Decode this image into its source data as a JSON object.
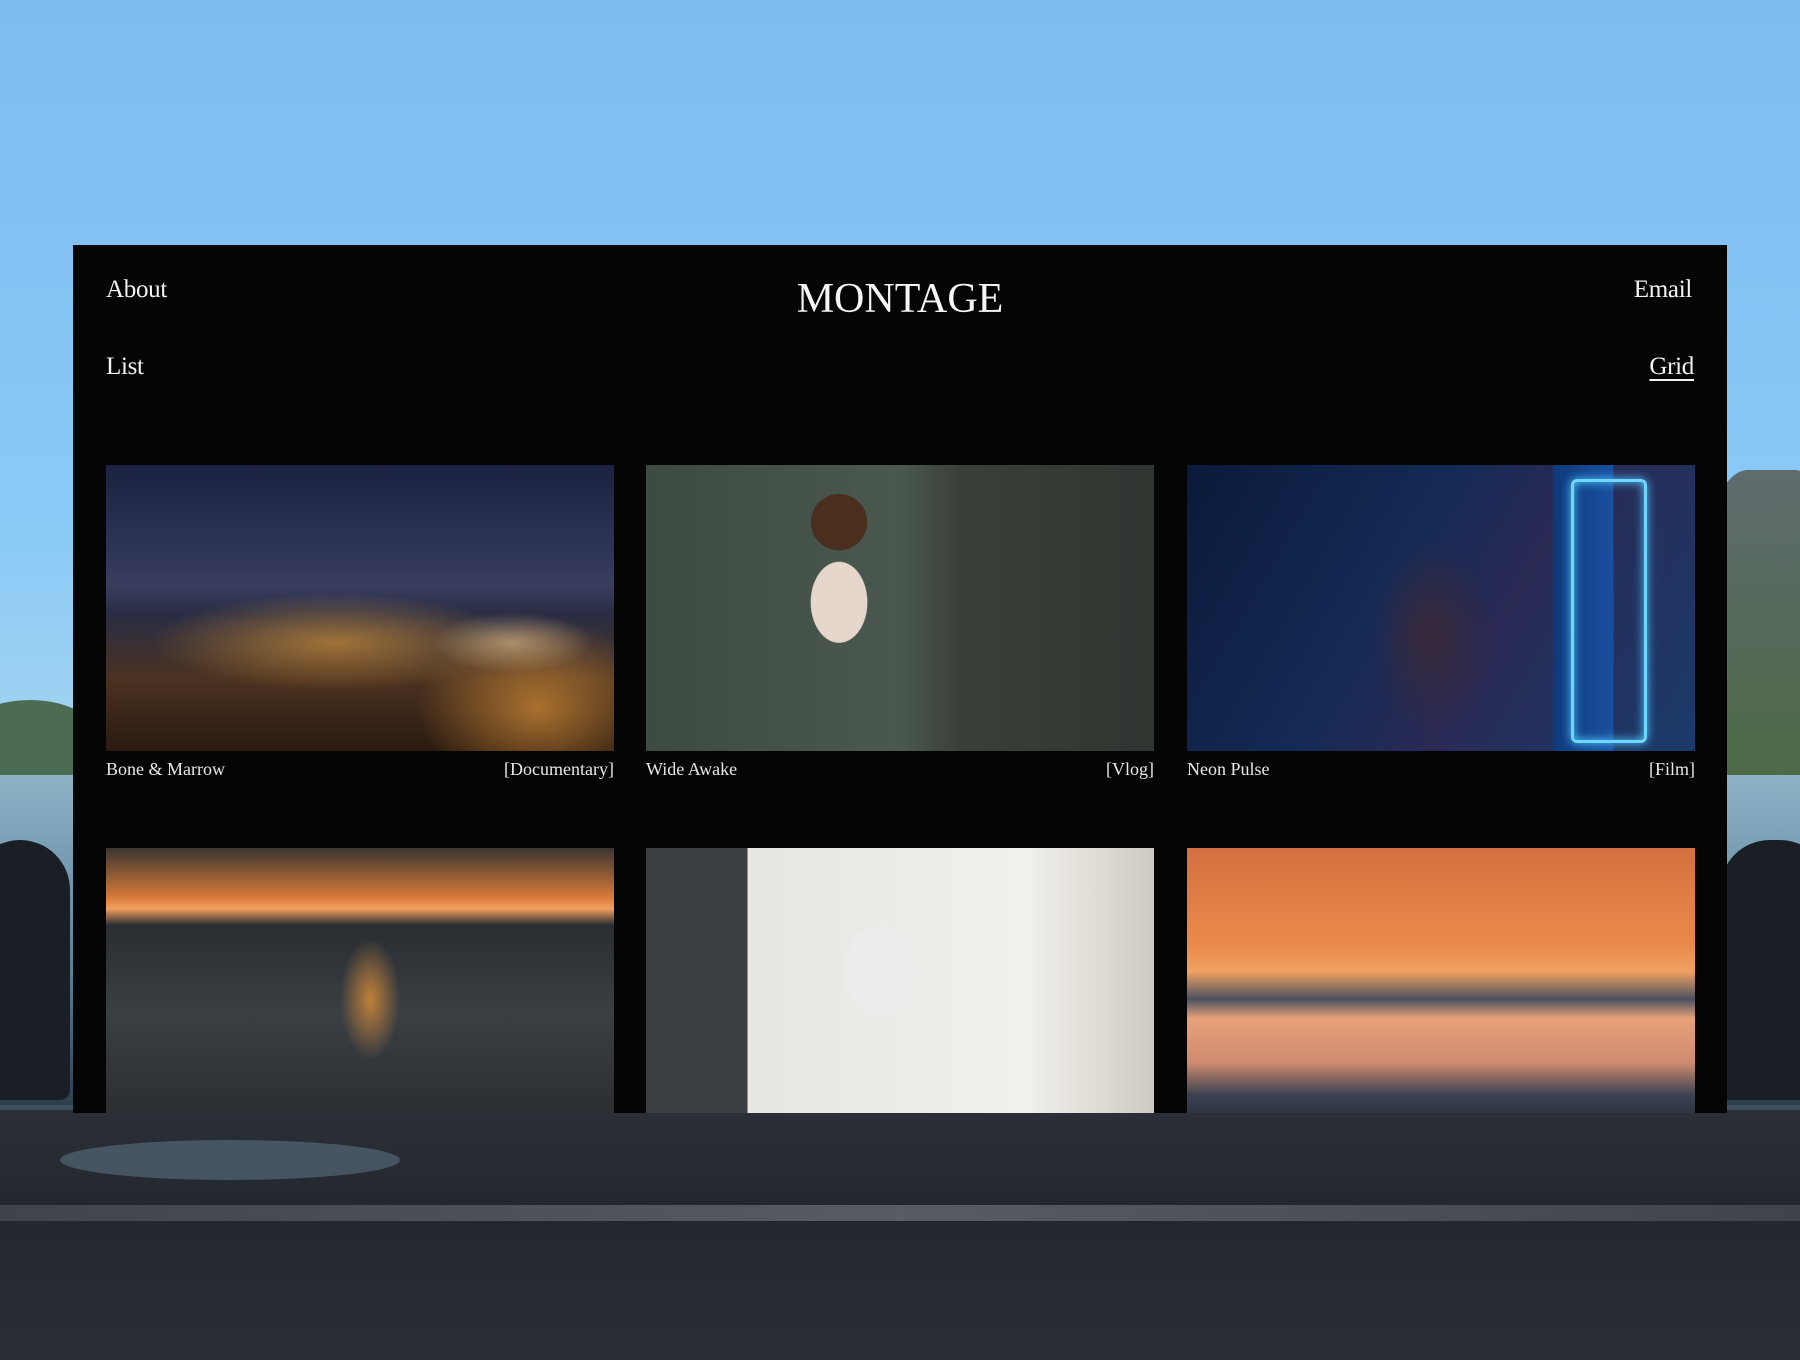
{
  "nav": {
    "about": "About",
    "email": "Email",
    "list": "List",
    "grid": "Grid"
  },
  "brand": {
    "logo": "MONTAGE"
  },
  "projects": [
    {
      "title": "Bone & Marrow",
      "category": "[Documentary]"
    },
    {
      "title": "Wide Awake",
      "category": "[Vlog]"
    },
    {
      "title": "Neon Pulse",
      "category": "[Film]"
    },
    {
      "title": "",
      "category": ""
    },
    {
      "title": "",
      "category": ""
    },
    {
      "title": "",
      "category": ""
    }
  ],
  "colors": {
    "window_bg": "#050505",
    "text": "#f3f3f3",
    "sky": "#8ccaf6"
  }
}
